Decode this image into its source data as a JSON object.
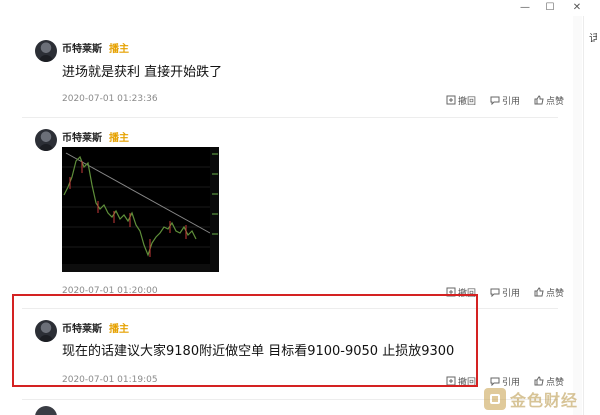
{
  "window": {
    "minimize_label": "—",
    "maximize_label": "☐",
    "close_label": "✕"
  },
  "right_panel": {
    "glyph": "话"
  },
  "posts": [
    {
      "author": "币特莱斯",
      "role": "播主",
      "content": "进场就是获利 直接开始跌了",
      "timestamp": "2020-07-01 01:23:36",
      "actions": {
        "recall": "撤回",
        "quote": "引用",
        "like": "点赞"
      }
    },
    {
      "author": "币特莱斯",
      "role": "播主",
      "content": "",
      "has_image": true,
      "image_icon": "candlestick-chart-image",
      "timestamp": "2020-07-01 01:20:00",
      "actions": {
        "recall": "撤回",
        "quote": "引用",
        "like": "点赞"
      }
    },
    {
      "author": "币特莱斯",
      "role": "播主",
      "content": "现在的话建议大家9180附近做空单 目标看9100-9050 止损放9300",
      "timestamp": "2020-07-01 01:19:05",
      "actions": {
        "recall": "撤回",
        "quote": "引用",
        "like": "点赞"
      }
    }
  ],
  "watermark": {
    "text": "金色财经"
  },
  "colors": {
    "role": "#e6a100",
    "highlight": "#d42222",
    "timestamp": "#8a8a8a"
  }
}
